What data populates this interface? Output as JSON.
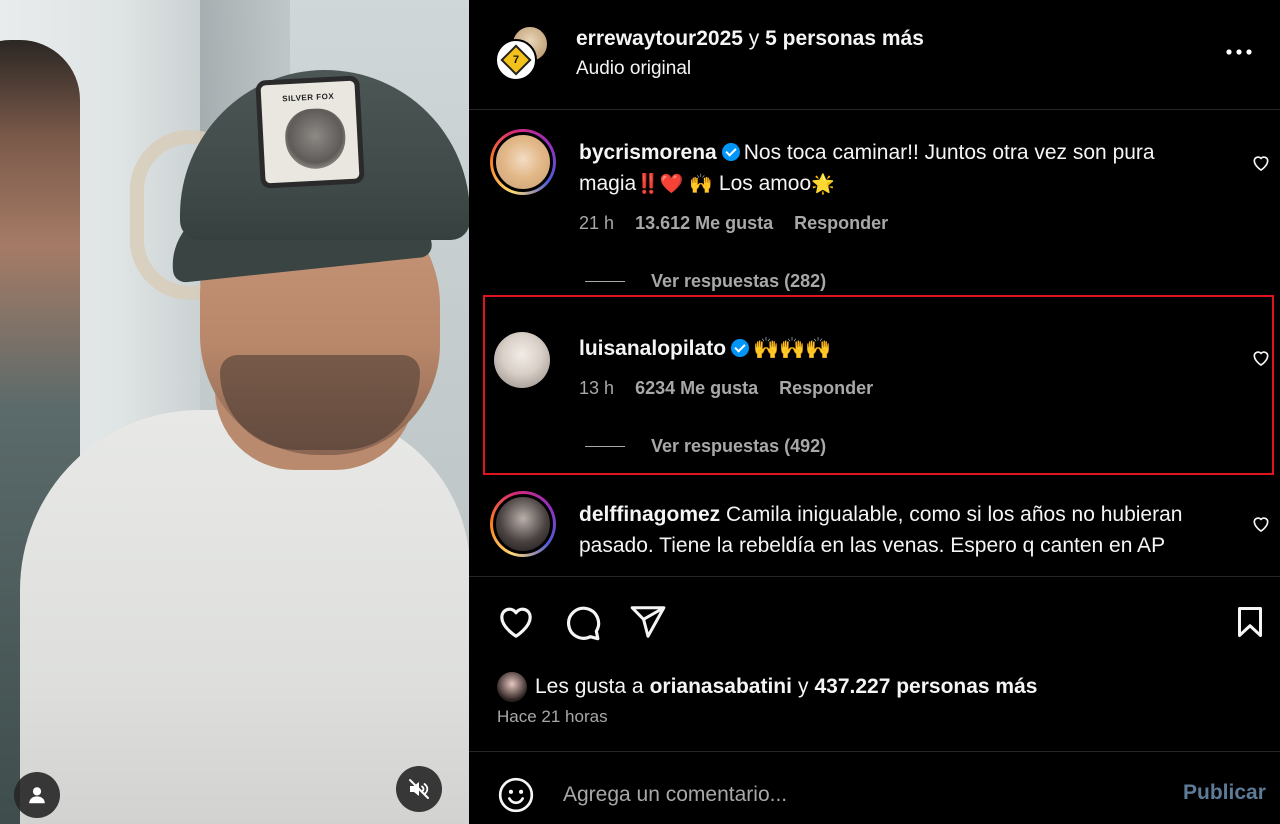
{
  "post": {
    "header": {
      "author": "errewaytour2025",
      "conjunction": "y",
      "others": "5 personas más",
      "audio": "Audio original"
    }
  },
  "comments": [
    {
      "user": "bycrismorena",
      "verified": true,
      "text": "Nos toca caminar!! Juntos otra vez son pura magia‼️❤️ 🙌 Los amoo🌟",
      "time": "21 h",
      "likes": "13.612 Me gusta",
      "reply": "Responder",
      "view_replies": "Ver respuestas (282)"
    },
    {
      "user": "luisanalopilato",
      "verified": true,
      "text": "🙌🙌🙌",
      "time": "13 h",
      "likes": "6234 Me gusta",
      "reply": "Responder",
      "view_replies": "Ver respuestas (492)"
    },
    {
      "user": "delffinagomez",
      "verified": false,
      "text": "Camila inigualable, como si los años no hubieran pasado. Tiene la rebeldía en las venas. Espero q canten en AP"
    }
  ],
  "likes": {
    "prefix": "Les gusta a",
    "user": "orianasabatini",
    "conjunction": "y",
    "count": "437.227 personas más"
  },
  "time_ago": "Hace 21 horas",
  "compose": {
    "placeholder": "Agrega un comentario...",
    "publish": "Publicar"
  },
  "media": {
    "cap_patch_text": "SILVER FOX"
  },
  "icons": {
    "more": "more-horizontal-icon",
    "like": "heart-icon",
    "comment": "comment-icon",
    "share": "send-icon",
    "save": "bookmark-icon",
    "emoji": "emoji-icon",
    "mute": "speaker-muted-icon",
    "tagged": "user-icon"
  },
  "colors": {
    "background": "#000000",
    "verified": "#0095f6",
    "muted_text": "#a8a8a8",
    "publish_disabled": "#5d7a96",
    "highlight_border": "#e0131f"
  }
}
